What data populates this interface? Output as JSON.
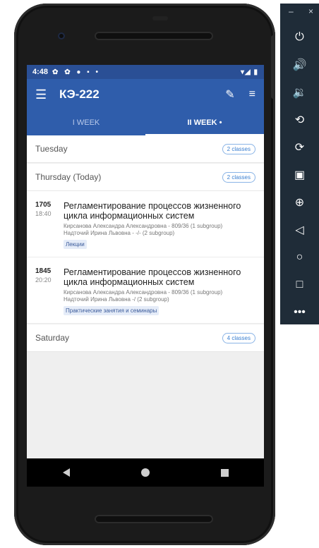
{
  "status_bar": {
    "time": "4:48",
    "left_icons": "✿ ✿ ● ▪ •",
    "right_icons": "▾◢ ▮"
  },
  "app_bar": {
    "title": "КЭ-222"
  },
  "tabs": [
    {
      "label": "I WEEK",
      "active": false
    },
    {
      "label": "II WEEK •",
      "active": true
    }
  ],
  "days": {
    "tuesday": {
      "name": "Tuesday",
      "badge": "2 classes"
    },
    "thursday": {
      "name": "Thursday (Today)",
      "badge": "2 classes"
    },
    "saturday": {
      "name": "Saturday",
      "badge": "4 classes"
    }
  },
  "lessons": [
    {
      "start": "1705",
      "end": "18:40",
      "name": "Регламентирование процессов жизненного цикла информационных систем",
      "teacher1": "Кирсанова Александра Александровна - 809/36 (1 subgroup)",
      "teacher2": "Надточий Ирина Львовна - -/- (2 subgroup)",
      "type": "Лекции"
    },
    {
      "start": "1845",
      "end": "20:20",
      "name": "Регламентирование процессов жизненного цикла информационных систем",
      "teacher1": "Кирсанова Александра Александровна - 809/36 (1 subgroup)",
      "teacher2": "Надточий Ирина Львовна  -/ (2 subgroup)",
      "type": "Практические занятия и семинары"
    }
  ],
  "emulator": {
    "minimize": "–",
    "close": "×",
    "icons": [
      "power-icon",
      "volume-up-icon",
      "volume-down-icon",
      "rotate-left-icon",
      "rotate-right-icon",
      "camera-icon",
      "zoom-icon",
      "back-icon",
      "home-icon",
      "overview-icon",
      "more-icon"
    ]
  },
  "colors": {
    "primary": "#2f5dab",
    "status_bar": "#2a4f95",
    "badge": "#3a7fd0",
    "emulator_bg": "#1f2c38"
  }
}
